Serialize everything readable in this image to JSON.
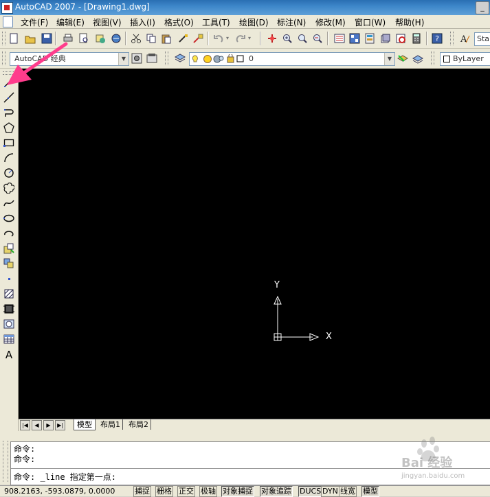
{
  "window": {
    "title": "AutoCAD 2007 - [Drawing1.dwg]"
  },
  "menu": [
    {
      "label": "文件(F)"
    },
    {
      "label": "编辑(E)"
    },
    {
      "label": "视图(V)"
    },
    {
      "label": "插入(I)"
    },
    {
      "label": "格式(O)"
    },
    {
      "label": "工具(T)"
    },
    {
      "label": "绘图(D)"
    },
    {
      "label": "标注(N)"
    },
    {
      "label": "修改(M)"
    },
    {
      "label": "窗口(W)"
    },
    {
      "label": "帮助(H)"
    }
  ],
  "toolbar": {
    "text_style_value": "Sta"
  },
  "workspace": {
    "value": "AutoCAD 经典"
  },
  "layer": {
    "value": "0"
  },
  "properties": {
    "color_value": "ByLayer"
  },
  "ucs": {
    "y_label": "Y",
    "x_label": "X"
  },
  "layout_tabs": [
    {
      "label": "模型"
    },
    {
      "label": "布局1"
    },
    {
      "label": "布局2"
    }
  ],
  "command": {
    "history": [
      "命令:",
      "命令:"
    ],
    "current": "命令: _line 指定第一点:"
  },
  "status": {
    "coordinates": "908.2163,  -593.0879,  0.0000",
    "toggles": [
      {
        "label": "捕捉",
        "on": false
      },
      {
        "label": "栅格",
        "on": false
      },
      {
        "label": "正交",
        "on": false
      },
      {
        "label": "极轴",
        "on": false
      },
      {
        "label": "对象捕捉",
        "on": true
      },
      {
        "label": "对象追踪",
        "on": true
      },
      {
        "label": "DUCS",
        "on": true
      },
      {
        "label": "DYN",
        "on": false
      },
      {
        "label": "线宽",
        "on": false
      },
      {
        "label": "模型",
        "on": true
      }
    ]
  },
  "watermark": {
    "brand": "Bai 经验",
    "url": "jingyan.baidu.com"
  },
  "colors": {
    "canvas": "#000000",
    "ucs": "#ffffff",
    "arrow": "#ff3c8c"
  }
}
